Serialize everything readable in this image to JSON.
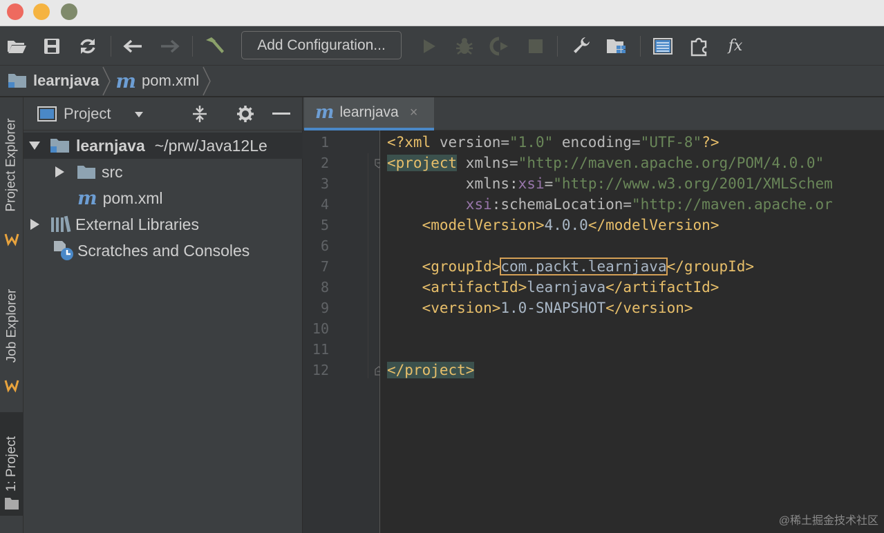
{
  "window": {
    "controls": [
      "close",
      "minimize",
      "maximize"
    ]
  },
  "toolbar": {
    "buttons": [
      "open-folder-icon",
      "save-icon",
      "sync-icon",
      "back-icon",
      "forward-icon",
      "build-icon"
    ],
    "config_label": "Add Configuration...",
    "run_buttons": [
      "run-icon",
      "debug-icon",
      "coverage-icon",
      "stop-icon"
    ],
    "tools": [
      "settings-wrench-icon",
      "project-structure-icon",
      "layout-icon",
      "plugin-icon"
    ],
    "fx_label": "fx"
  },
  "breadcrumb": {
    "items": [
      {
        "label": "learnjava",
        "icon": "module-folder-icon"
      },
      {
        "label": "pom.xml",
        "icon": "maven-icon",
        "icon_glyph": "m"
      }
    ]
  },
  "tool_strip": {
    "tabs": [
      {
        "label": "Project Explorer"
      },
      {
        "label": "Job Explorer"
      },
      {
        "label": "1: Project",
        "active": true
      }
    ]
  },
  "project_panel": {
    "title": "Project",
    "tree": [
      {
        "name": "learnjava",
        "path": "~/prw/Java12Le",
        "expanded": true,
        "icon": "module-folder-icon"
      },
      {
        "name": "src",
        "icon": "folder-icon",
        "expanded": false
      },
      {
        "name": "pom.xml",
        "icon": "maven-icon"
      },
      {
        "name": "External Libraries",
        "icon": "libraries-icon",
        "expanded": false
      },
      {
        "name": "Scratches and Consoles",
        "icon": "scratches-icon"
      }
    ]
  },
  "editor": {
    "tab": {
      "label": "learnjava",
      "close": "×",
      "icon_glyph": "m"
    },
    "line_numbers": [
      "1",
      "2",
      "3",
      "4",
      "5",
      "6",
      "7",
      "8",
      "9",
      "10",
      "11",
      "12"
    ],
    "lines": {
      "l1": {
        "decl_open": "<?xml",
        "v_attr": " version=",
        "v_val": "\"1.0\"",
        "e_attr": " encoding=",
        "e_val": "\"UTF-8\"",
        "decl_close": "?>"
      },
      "l2": {
        "tag": "<project",
        "attr": " xmlns=",
        "val": "\"http://maven.apache.org/POM/4.0.0\""
      },
      "l3": {
        "indent": "         ",
        "prefix": "xmlns:",
        "ns": "xsi",
        "eq": "=",
        "val": "\"http://www.w3.org/2001/XMLSchem"
      },
      "l4": {
        "indent": "         ",
        "ns": "xsi",
        "attr": ":schemaLocation=",
        "val": "\"http://maven.apache.or"
      },
      "l5": {
        "indent": "    ",
        "open": "<modelVersion>",
        "text": "4.0.0",
        "close": "</modelVersion>"
      },
      "l7": {
        "indent": "    ",
        "open": "<groupId>",
        "text": "com.packt.learnjava",
        "close": "</groupId>"
      },
      "l8": {
        "indent": "    ",
        "open": "<artifactId>",
        "text": "learnjava",
        "close": "</artifactId>"
      },
      "l9": {
        "indent": "    ",
        "open": "<version>",
        "text": "1.0-SNAPSHOT",
        "close": "</version>"
      },
      "l12": {
        "close": "</project>"
      }
    }
  },
  "watermark": "@稀土掘金技术社区",
  "colors": {
    "accent": "#4a88c7",
    "tag": "#e8bf6a",
    "string": "#6a8759",
    "namespace": "#9876aa",
    "background": "#2b2b2b"
  }
}
